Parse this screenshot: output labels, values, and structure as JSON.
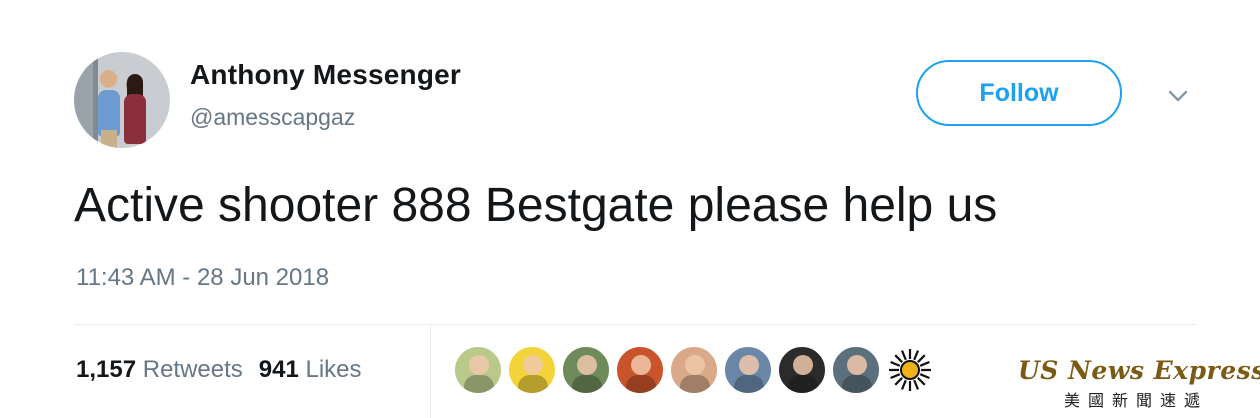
{
  "tweet": {
    "author_name": "Anthony Messenger",
    "author_handle": "@amesscapgaz",
    "text": "Active shooter 888 Bestgate please help us",
    "timestamp": "11:43 AM - 28 Jun 2018",
    "follow_label": "Follow",
    "stats": {
      "retweets_count": "1,157",
      "retweets_label": "Retweets",
      "likes_count": "941",
      "likes_label": "Likes"
    }
  },
  "likers": [
    {
      "name": "liker-avatar-1",
      "bg": "#b9c98a"
    },
    {
      "name": "liker-avatar-2",
      "bg": "#f2d33a"
    },
    {
      "name": "liker-avatar-3",
      "bg": "#6f8a5b"
    },
    {
      "name": "liker-avatar-4",
      "bg": "#c9542b"
    },
    {
      "name": "liker-avatar-5",
      "bg": "#d9a98a"
    },
    {
      "name": "liker-avatar-6",
      "bg": "#6b87a8"
    },
    {
      "name": "liker-avatar-7",
      "bg": "#2b2b2b"
    },
    {
      "name": "liker-avatar-8",
      "bg": "#5c6f7d"
    },
    {
      "name": "liker-avatar-9",
      "bg": "#ffffff"
    }
  ],
  "watermark": {
    "title": "US News Express",
    "subtitle": "美國新聞速遞"
  },
  "colors": {
    "accent": "#1da1f2",
    "text_primary": "#14171a",
    "text_secondary": "#657786",
    "divider": "#e6ecf0"
  },
  "icons": {
    "more": "chevron-down-icon"
  }
}
